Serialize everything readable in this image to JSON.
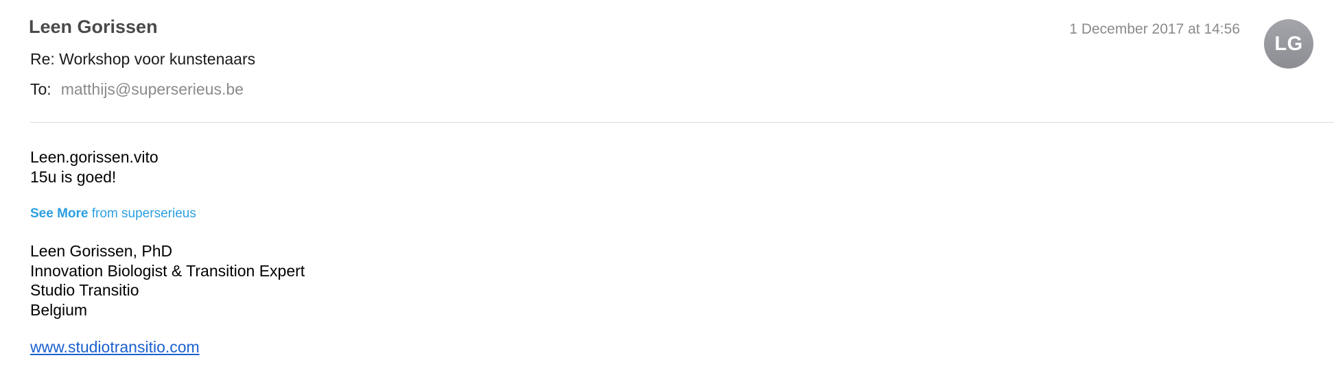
{
  "header": {
    "sender": "Leen Gorissen",
    "subject": "Re: Workshop voor kunstenaars",
    "to_label": "To:",
    "to_address": "matthijs@superserieus.be",
    "date": "1 December 2017 at 14:56",
    "avatar_initials": "LG"
  },
  "message": {
    "lines": [
      "Leen.gorissen.vito",
      "15u is goed!"
    ],
    "see_more_bold": "See More",
    "see_more_rest": "from superserieus",
    "signature": [
      "Leen Gorissen, PhD",
      "Innovation Biologist & Transition Expert",
      "Studio Transitio",
      "Belgium"
    ],
    "website": "www.studiotransitio.com"
  },
  "colors": {
    "link": "#1a5fcf",
    "see_more": "#2a9fe0",
    "avatar": "#9a9ba0"
  }
}
